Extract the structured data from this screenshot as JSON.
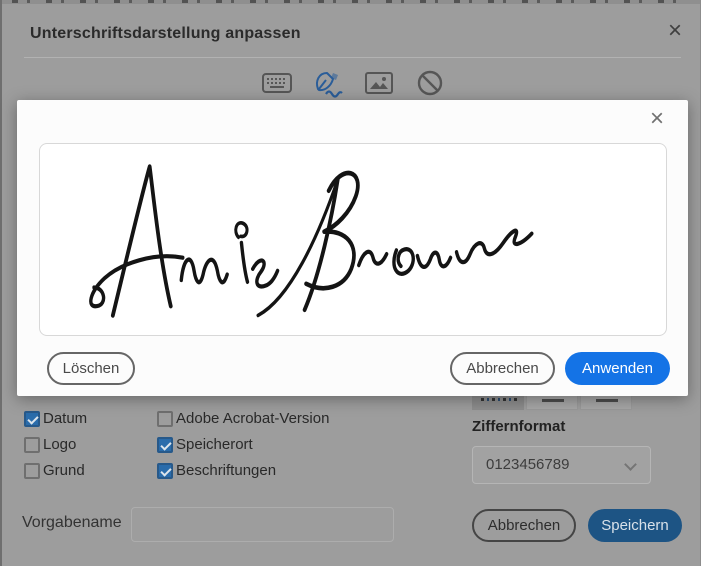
{
  "dialog": {
    "title": "Unterschriftsdarstellung anpassen",
    "close_icon": "×",
    "tab_icons": [
      {
        "name": "keyboard-icon",
        "selected": false
      },
      {
        "name": "draw-icon",
        "selected": true
      },
      {
        "name": "image-icon",
        "selected": false
      },
      {
        "name": "none-icon",
        "selected": false
      }
    ],
    "checkbox_columns": [
      {
        "items": [
          {
            "label": "Datum",
            "checked": true
          },
          {
            "label": "Logo",
            "checked": false
          },
          {
            "label": "Grund",
            "checked": false
          }
        ]
      },
      {
        "items": [
          {
            "label": "Adobe Acrobat-Version",
            "checked": false
          },
          {
            "label": "Speicherort",
            "checked": true
          },
          {
            "label": "Beschriftungen",
            "checked": true
          }
        ]
      }
    ],
    "ziffernformat": {
      "label": "Ziffernformat",
      "value": "0123456789"
    },
    "vorgabename": {
      "label": "Vorgabename",
      "value": ""
    },
    "buttons": {
      "cancel": "Abbrechen",
      "save": "Speichern"
    },
    "colors": {
      "accent_blue": "#1473e6",
      "dimmed_save_blue": "#1d5484",
      "checkbox_blue": "#2a6cab"
    }
  },
  "modal": {
    "close_icon": "×",
    "signature_text": "Annie Brown",
    "buttons": {
      "delete": "Löschen",
      "cancel": "Abbrechen",
      "apply": "Anwenden"
    }
  }
}
